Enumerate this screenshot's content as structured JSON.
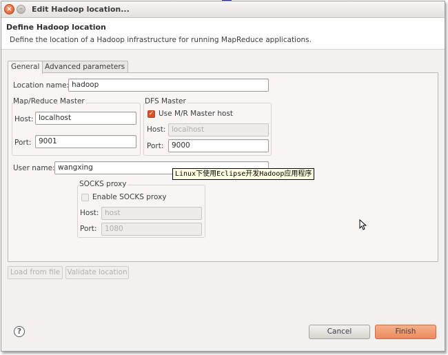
{
  "window": {
    "title": "Edit Hadoop location...",
    "close_symbol": "×",
    "minimize_symbol": "–",
    "maximize_symbol": "□"
  },
  "header": {
    "title": "Define Hadoop location",
    "description": "Define the location of a Hadoop infrastructure for running MapReduce applications."
  },
  "tabs": [
    {
      "label": "General",
      "active": true
    },
    {
      "label": "Advanced parameters",
      "active": false
    }
  ],
  "general": {
    "location_name_label": "Location name:",
    "location_name_value": "hadoop",
    "mapred": {
      "title": "Map/Reduce Master",
      "host_label": "Host:",
      "host_value": "localhost",
      "port_label": "Port:",
      "port_value": "9001"
    },
    "dfs": {
      "title": "DFS Master",
      "use_mr_host_label": "Use M/R Master host",
      "use_mr_host_checked": true,
      "host_label": "Host:",
      "host_value": "localhost",
      "port_label": "Port:",
      "port_value": "9000"
    },
    "user_name_label": "User name:",
    "user_name_value": "wangxing",
    "socks": {
      "title": "SOCKS proxy",
      "enable_label": "Enable SOCKS proxy",
      "enable_checked": false,
      "host_label": "Host:",
      "host_value": "host",
      "port_label": "Port:",
      "port_value": "1080"
    }
  },
  "actions": {
    "load_from_file": "Load from file",
    "validate_location": "Validate location"
  },
  "tooltip": "Linux下使用Eclipse开发Hadoop应用程序",
  "footer": {
    "help_symbol": "?",
    "cancel": "Cancel",
    "finish": "Finish"
  },
  "colors": {
    "accent": "#ec8a5c",
    "checkbox_checked": "#d9532a",
    "close_button": "#dc4d1e"
  },
  "icons": {
    "close": "close-icon",
    "help": "help-icon",
    "checkmark": "checkmark-icon",
    "cursor": "mouse-cursor-icon"
  }
}
